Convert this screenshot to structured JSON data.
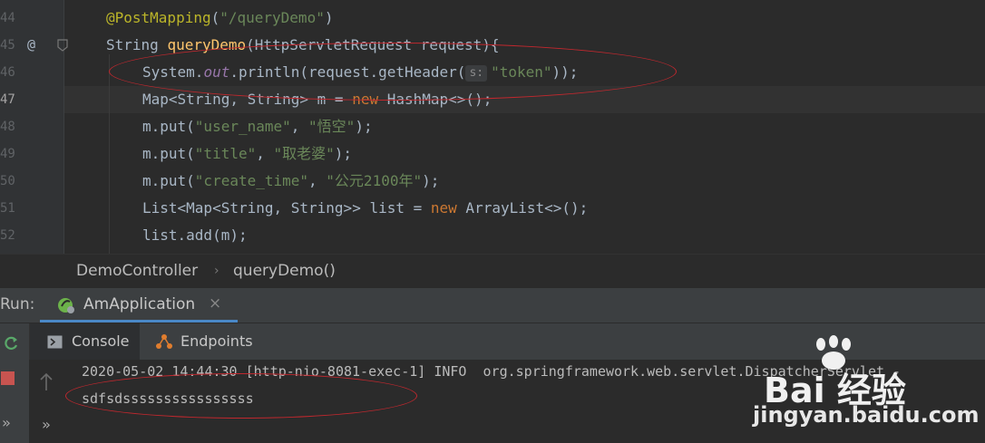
{
  "editor": {
    "line_numbers": [
      "44",
      "45",
      "46",
      "47",
      "48",
      "49",
      "50",
      "51",
      "52"
    ],
    "gutter_marks": {
      "at": "@"
    },
    "lines": {
      "l44": {
        "annotation": "@PostMapping",
        "paren_open": "(",
        "str": "\"/queryDemo\"",
        "paren_close": ")"
      },
      "l45": {
        "type": "String ",
        "method": "queryDemo",
        "rest": "(HttpServletRequest request){"
      },
      "l46": {
        "pre": "System.",
        "field": "out",
        "mid": ".println(request.getHeader(",
        "hint": "s:",
        "str": "\"token\"",
        "post": "));"
      },
      "l47": {
        "pre": "Map<String, String> m = ",
        "kw": "new",
        "post": " HashMap<>();"
      },
      "l48": {
        "pre": "m.put(",
        "s1": "\"user_name\"",
        "sep": ", ",
        "s2": "\"悟空\"",
        "post": ");"
      },
      "l49": {
        "pre": "m.put(",
        "s1": "\"title\"",
        "sep": ", ",
        "s2": "\"取老婆\"",
        "post": ");"
      },
      "l50": {
        "pre": "m.put(",
        "s1": "\"create_time\"",
        "sep": ", ",
        "s2": "\"公元2100年\"",
        "post": ");"
      },
      "l51": {
        "pre": "List<Map<String, String>> list = ",
        "kw": "new",
        "post": " ArrayList<>();"
      },
      "l52": {
        "text": "list.add(m);"
      }
    }
  },
  "breadcrumb": {
    "class_name": "DemoController",
    "separator": "›",
    "method": "queryDemo()"
  },
  "run": {
    "label": "Run:",
    "tab": "AmApplication",
    "close": "×"
  },
  "subtabs": {
    "console": "Console",
    "endpoints": "Endpoints"
  },
  "console": {
    "lines": [
      "2020-05-02 14:44:30 [http-nio-8081-exec-1] INFO  org.springframework.web.servlet.DispatcherServlet -",
      "sdfsdssssssssssssssss"
    ]
  },
  "side": {
    "expand": "»",
    "more": "»"
  },
  "watermark": {
    "logo": "Bai 经验",
    "url": "jingyan.baidu.com"
  },
  "colors": {
    "accent": "#4a88c7",
    "annotation_ellipse": "#c0282e",
    "string": "#6a8759",
    "keyword": "#cc7832"
  }
}
